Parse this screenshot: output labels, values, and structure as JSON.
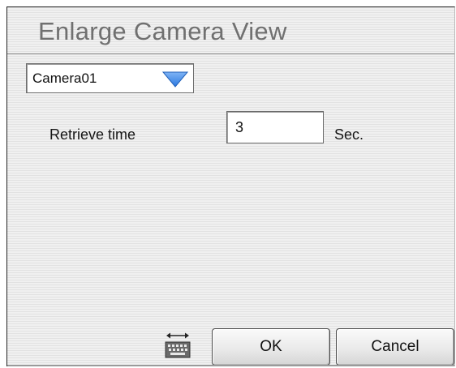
{
  "dialog": {
    "title": "Enlarge Camera View"
  },
  "camera_select": {
    "value": "Camera01",
    "icon": "dropdown-arrow-icon"
  },
  "retrieve": {
    "label": "Retrieve time",
    "value": "3",
    "unit": "Sec."
  },
  "footer": {
    "keyboard_icon": "keyboard-icon",
    "ok_label": "OK",
    "cancel_label": "Cancel"
  },
  "colors": {
    "arrow_fill": "#3a87e6",
    "title_text": "#707070"
  }
}
